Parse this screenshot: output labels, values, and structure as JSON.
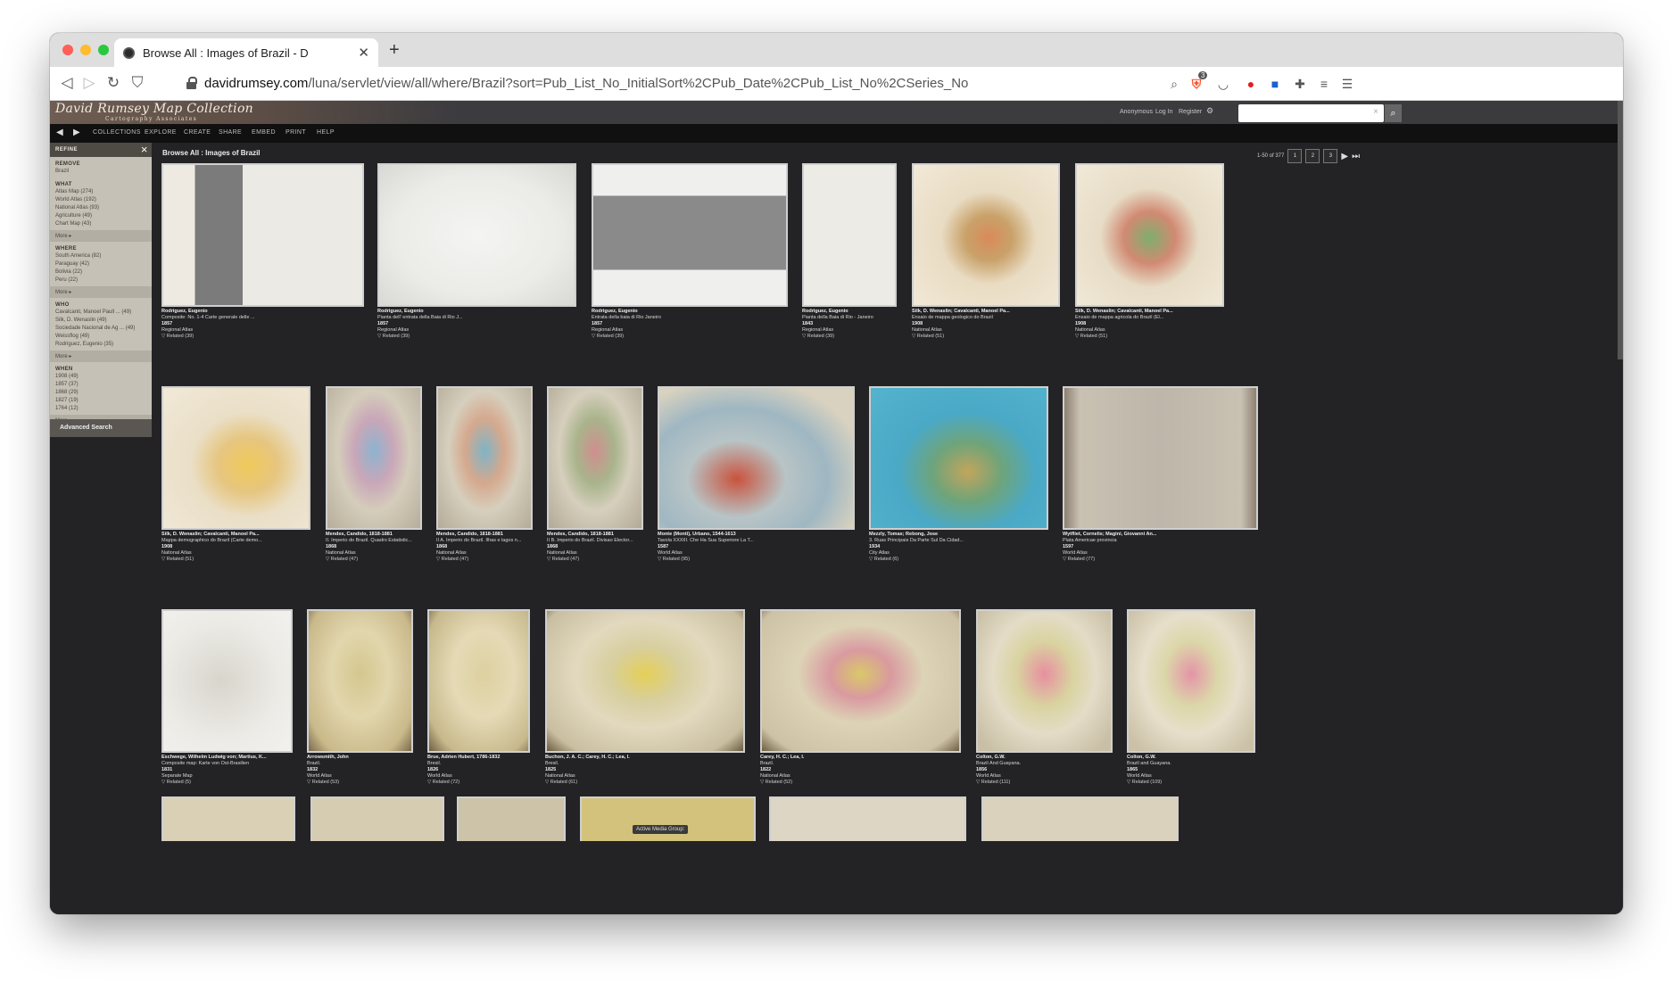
{
  "browser": {
    "tab_title": "Browse All : Images of Brazil - D",
    "url_host": "davidrumsey.com",
    "url_path": "/luna/servlet/view/all/where/Brazil?sort=Pub_List_No_InitialSort%2CPub_Date%2CPub_List_No%2CSeries_No",
    "extension_badge": "3"
  },
  "site": {
    "logo_title": "David Rumsey Map Collection",
    "logo_subtitle": "Cartography Associates",
    "user_links": [
      "Anonymous",
      "Log In",
      "Register"
    ],
    "search_placeholder": "",
    "nav": [
      "COLLECTIONS",
      "EXPLORE",
      "CREATE",
      "SHARE",
      "EMBED",
      "PRINT",
      "HELP"
    ],
    "active_media_group": "Active Media Group:"
  },
  "refine": {
    "title": "REFINE",
    "remove_label": "REMOVE",
    "remove_items": [
      "Brazil"
    ],
    "what_label": "WHAT",
    "what_items": [
      "Atlas Map (274)",
      "World Atlas (192)",
      "National Atlas (93)",
      "Agriculture (49)",
      "Chart Map (43)"
    ],
    "where_label": "WHERE",
    "where_items": [
      "South America (82)",
      "Paraguay (42)",
      "Bolivia (22)",
      "Peru (22)"
    ],
    "who_label": "WHO",
    "who_items": [
      "Cavalcanti, Manoel Paull ... (49)",
      "Silk, D. Wenaslin (49)",
      "Sociedade Nacional de Ag ... (49)",
      "Weissflog (49)",
      "Rodriguez, Eugenio (35)"
    ],
    "when_label": "WHEN",
    "when_items": [
      "1908 (49)",
      "1857 (37)",
      "1868 (29)",
      "1827 (19)",
      "1764 (12)"
    ],
    "more_label": "More",
    "advanced_search": "Advanced Search"
  },
  "main": {
    "browse_title": "Browse All : Images of Brazil",
    "results_count": "1-50 of 377",
    "pages": [
      "1",
      "2",
      "3"
    ],
    "results": [
      {
        "author": "Rodriguez, Eugenio",
        "title": "Composite: No. 1-4 Carte generale delle ...",
        "date": "1857",
        "type": "Regional Atlas",
        "related": "Related (39)"
      },
      {
        "author": "Rodriguez, Eugenio",
        "title": "Pianta dell' entrata della Baia di Rio J...",
        "date": "1857",
        "type": "Regional Atlas",
        "related": "Related (39)"
      },
      {
        "author": "Rodriguez, Eugenio",
        "title": "Entrata della baia di Rio Janeiro",
        "date": "1857",
        "type": "Regional Atlas",
        "related": "Related (39)"
      },
      {
        "author": "Rodriguez, Eugenio",
        "title": "Pianta della Baia di Rio - Janeiro",
        "date": "1843",
        "type": "Regional Atlas",
        "related": "Related (39)"
      },
      {
        "author": "Silk, D. Wenaslin; Cavalcanti, Manoel Pa...",
        "title": "Ensaio de mappa geologico do Brazil",
        "date": "1908",
        "type": "National Atlas",
        "related": "Related (51)"
      },
      {
        "author": "Silk, D. Wenaslin; Cavalcanti, Manoel Pa...",
        "title": "Ensaio de mappa agricola do Brazil (El...",
        "date": "1908",
        "type": "National Atlas",
        "related": "Related (51)"
      },
      {
        "author": "Silk, D. Wenaslin; Cavalcanti, Manoel Pa...",
        "title": "Mappa demographico do Brazil (Carte demo...",
        "date": "1908",
        "type": "National Atlas",
        "related": "Related (51)"
      },
      {
        "author": "Mendes, Candido, 1818-1881",
        "title": "II. Imperio do Brazil. Quadro Estatistic...",
        "date": "1868",
        "type": "National Atlas",
        "related": "Related (47)"
      },
      {
        "author": "Mendes, Candido, 1818-1881",
        "title": "II A. Imperio do Brazil. Ilhas e lagos n...",
        "date": "1868",
        "type": "National Atlas",
        "related": "Related (47)"
      },
      {
        "author": "Mendes, Candido, 1818-1881",
        "title": "II B. Imperio do Brazil. Divisao Elector...",
        "date": "1868",
        "type": "National Atlas",
        "related": "Related (47)"
      },
      {
        "author": "Monte (Monti), Urbano, 1544-1613",
        "title": "Tavola XXXIII. Che Ha Sua Superiore La T...",
        "date": "1587",
        "type": "World Atlas",
        "related": "Related (95)"
      },
      {
        "author": "Mezzly, Tomas; Rebong, Jose",
        "title": "3. Ruas Principais Da Parte Sul Da Cidad...",
        "date": "1934",
        "type": "City Atlas",
        "related": "Related (6)"
      },
      {
        "author": "Wytfliet, Cornelis; Magini, Giovanni An...",
        "title": "Plata Americae provincia",
        "date": "1597",
        "type": "World Atlas",
        "related": "Related (77)"
      },
      {
        "author": "Eschwege, Wilhelm Ludwig von; Martius, K...",
        "title": "Composite map: Karte von Ost-Brasilien",
        "date": "1831",
        "type": "Separate Map",
        "related": "Related (5)"
      },
      {
        "author": "Arrowsmith, John",
        "title": "Brazil.",
        "date": "1832",
        "type": "World Atlas",
        "related": "Related (53)"
      },
      {
        "author": "Brue, Adrien Hubert, 1786-1832",
        "title": "Bresil.",
        "date": "1826",
        "type": "World Atlas",
        "related": "Related (72)"
      },
      {
        "author": "Buchon, J. A. C.; Carey, H. C.; Lea, I.",
        "title": "Bresil.",
        "date": "1825",
        "type": "National Atlas",
        "related": "Related (61)"
      },
      {
        "author": "Carey, H. C.; Lea, I.",
        "title": "Brazil.",
        "date": "1822",
        "type": "National Atlas",
        "related": "Related (52)"
      },
      {
        "author": "Colton, G.W.",
        "title": "Brazil And Guayana.",
        "date": "1856",
        "type": "World Atlas",
        "related": "Related (111)"
      },
      {
        "author": "Colton, G.W.",
        "title": "Brazil and Guayana.",
        "date": "1865",
        "type": "World Atlas",
        "related": "Related (109)"
      }
    ]
  },
  "colors": {
    "page_bg": "#232325",
    "refine_bg": "#c6c1b6",
    "navbar_bg": "#101010"
  }
}
